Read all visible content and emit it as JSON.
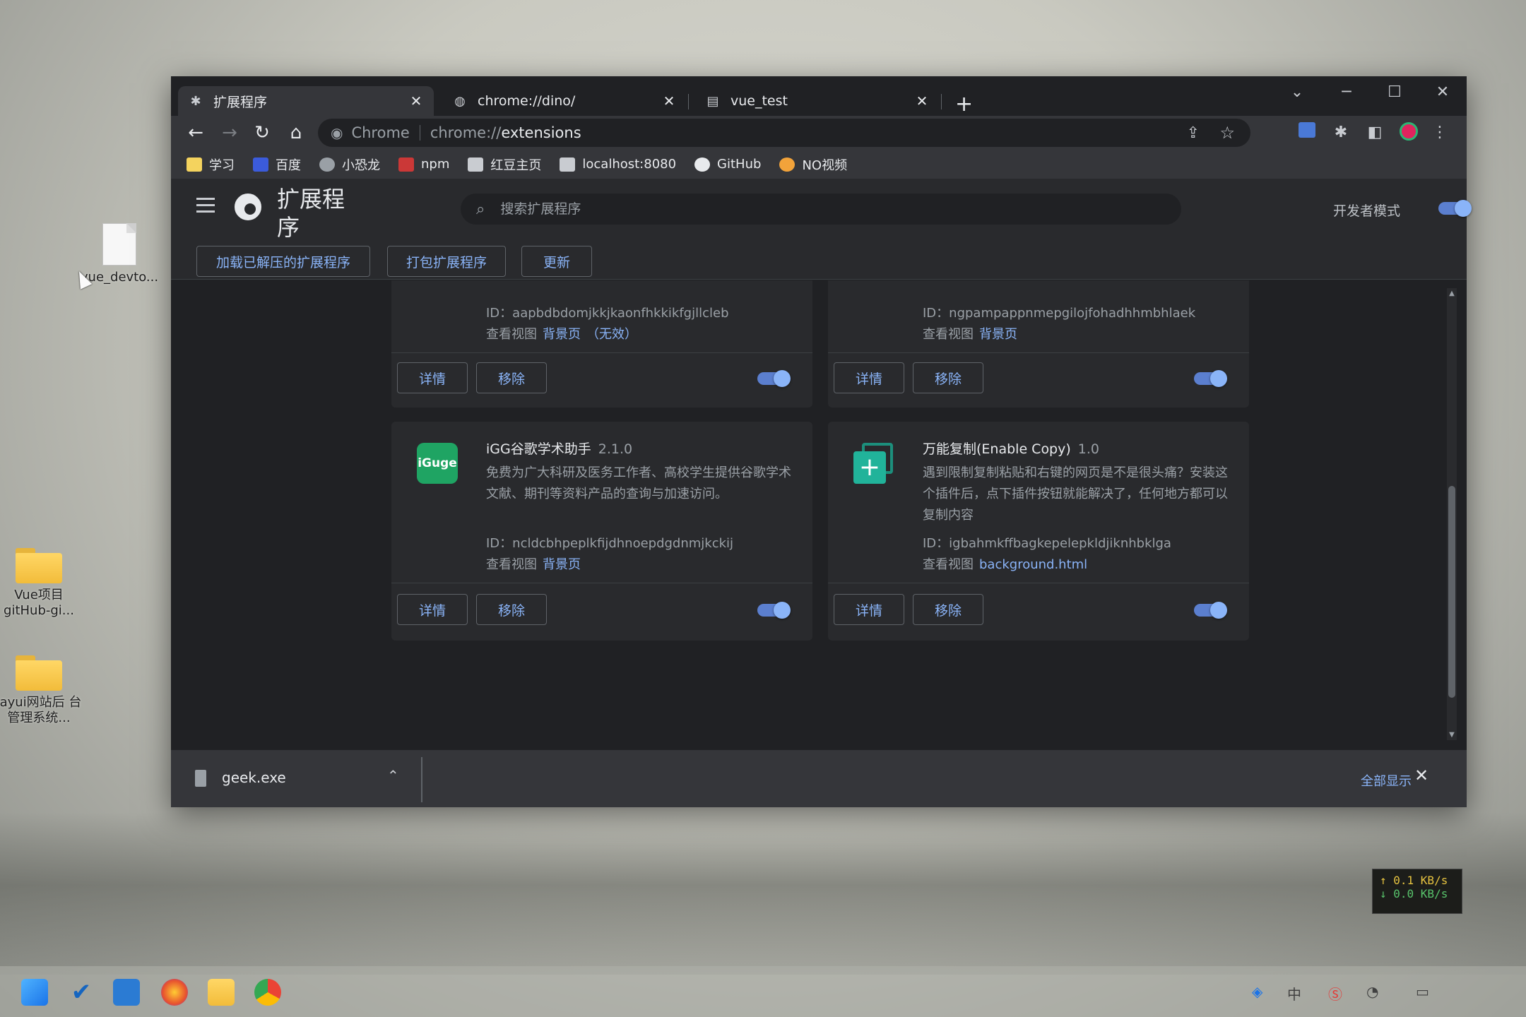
{
  "desktop": {
    "icons": [
      {
        "label": "vue_devto..."
      },
      {
        "label": "Vue项目 gitHub-gi..."
      },
      {
        "label": "layui网站后 台管理系统..."
      }
    ]
  },
  "browser": {
    "tabs": [
      {
        "title": "扩展程序",
        "icon": "puzzle-icon",
        "active": true
      },
      {
        "title": "chrome://dino/",
        "icon": "globe-icon",
        "active": false
      },
      {
        "title": "vue_test",
        "icon": "page-icon",
        "active": false
      }
    ],
    "new_tab": "+",
    "window_controls": {
      "dropdown": "⌄",
      "minimize": "─",
      "maximize": "☐",
      "close": "✕"
    },
    "toolbar": {
      "back": "←",
      "forward": "→",
      "reload": "↻",
      "home": "⌂",
      "omnibox_chrome": "Chrome",
      "omnibox_scheme": "chrome://",
      "omnibox_path": "extensions"
    },
    "bookmarks": [
      {
        "label": "学习",
        "color": "#f4d35e"
      },
      {
        "label": "百度",
        "color": "#3b5bdb"
      },
      {
        "label": "小恐龙",
        "color": "#9aa0a6"
      },
      {
        "label": "npm",
        "color": "#cb3837"
      },
      {
        "label": "红豆主页",
        "color": "#c9ccd1"
      },
      {
        "label": "localhost:8080",
        "color": "#c9ccd1"
      },
      {
        "label": "GitHub",
        "color": "#e8eaed"
      },
      {
        "label": "NO视频",
        "color": "#f2a33a"
      }
    ]
  },
  "extensions_page": {
    "title": "扩展程序",
    "search_placeholder": "搜索扩展程序",
    "dev_mode_label": "开发者模式",
    "dev_mode_on": true,
    "dev_buttons": {
      "load_unpacked": "加载已解压的扩展程序",
      "pack": "打包扩展程序",
      "update": "更新"
    },
    "cards": [
      {
        "name": "",
        "version": "",
        "description": "",
        "id_label": "ID：",
        "id": "aapbdbdomjkkjkaonfhkkikfgjllcleb",
        "views_label": "查看视图",
        "view_link": "背景页",
        "view_extra": "（无效）",
        "details": "详情",
        "remove": "移除",
        "enabled": true
      },
      {
        "name": "",
        "version": "",
        "description": "",
        "id_label": "ID：",
        "id": "ngpampappnmepgilojfohadhhmbhlaek",
        "views_label": "查看视图",
        "view_link": "背景页",
        "view_extra": "",
        "details": "详情",
        "remove": "移除",
        "enabled": true
      },
      {
        "name": "iGG谷歌学术助手",
        "version": "2.1.0",
        "description": "免费为广大科研及医务工作者、高校学生提供谷歌学术文献、期刊等资料产品的查询与加速访问。",
        "icon_text": "iGuge",
        "icon_color": "#1fa463",
        "id_label": "ID：",
        "id": "ncldcbhpeplkfijdhnoepdgdnmjkckij",
        "views_label": "查看视图",
        "view_link": "背景页",
        "view_extra": "",
        "details": "详情",
        "remove": "移除",
        "enabled": true
      },
      {
        "name": "万能复制(Enable Copy)",
        "version": "1.0",
        "description": "遇到限制复制粘贴和右键的网页是不是很头痛？安装这个插件后，点下插件按钮就能解决了，任何地方都可以复制内容",
        "icon_color": "#21b39a",
        "id_label": "ID：",
        "id": "igbahmkffbagkepelepkldjiknhbklga",
        "views_label": "查看视图",
        "view_link": "background.html",
        "view_extra": "",
        "details": "详情",
        "remove": "移除",
        "enabled": true
      }
    ]
  },
  "download_bar": {
    "file": "geek.exe",
    "show_all": "全部显示",
    "close": "✕"
  },
  "net_monitor": {
    "up": "↑ 0.1 KB/s",
    "down": "↓ 0.0 KB/s"
  },
  "colors": {
    "accent": "#8ab4f8",
    "surface": "#292a2d",
    "background": "#202124"
  }
}
